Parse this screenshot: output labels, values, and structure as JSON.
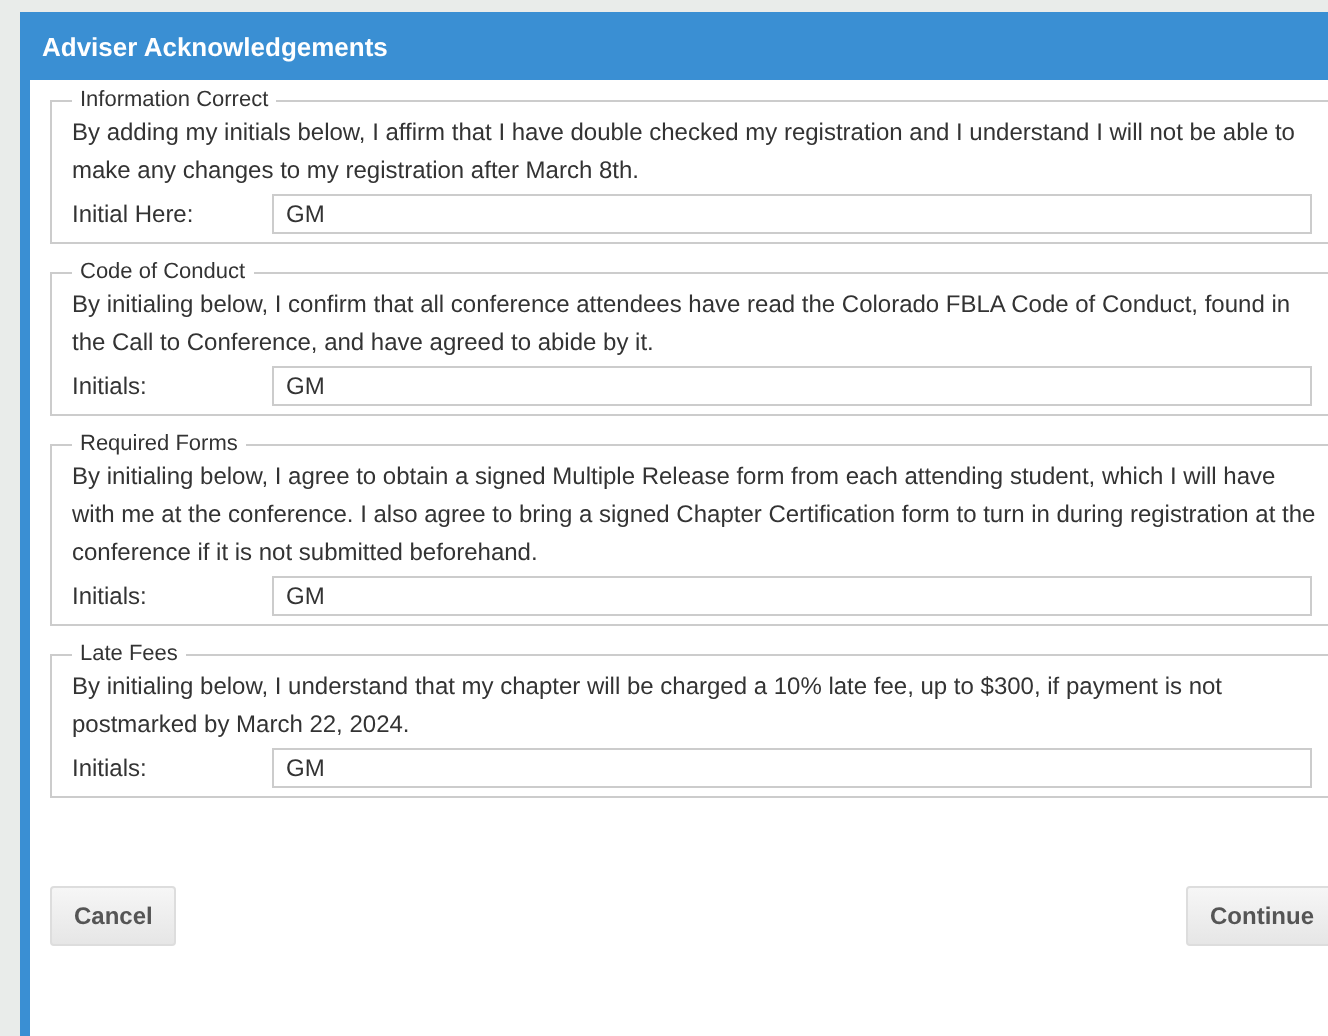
{
  "window": {
    "title": "Adviser Acknowledgements"
  },
  "sections": [
    {
      "legend": "Information Correct",
      "text": "By adding my initials below, I affirm that I have double checked my registration and I understand I will not be able to make any changes to my registration after March 8th.",
      "field_label": "Initial Here:",
      "value": "GM"
    },
    {
      "legend": "Code of Conduct",
      "text": "By initialing below, I confirm that all conference attendees have read the Colorado FBLA Code of Conduct, found in the Call to Conference, and have agreed to abide by it.",
      "field_label": "Initials:",
      "value": "GM"
    },
    {
      "legend": "Required Forms",
      "text": "By initialing below, I agree to obtain a signed Multiple Release form from each attending student, which I will have with me at the conference. I also agree to bring a signed Chapter Certification form to turn in during registration at the conference if it is not submitted beforehand.",
      "field_label": "Initials:",
      "value": "GM"
    },
    {
      "legend": "Late Fees",
      "text": "By initialing below, I understand that my chapter will be charged a 10% late fee, up to $300, if payment is not postmarked by March 22, 2024.",
      "field_label": "Initials:",
      "value": "GM"
    }
  ],
  "buttons": [
    "Cancel",
    "Continue"
  ]
}
